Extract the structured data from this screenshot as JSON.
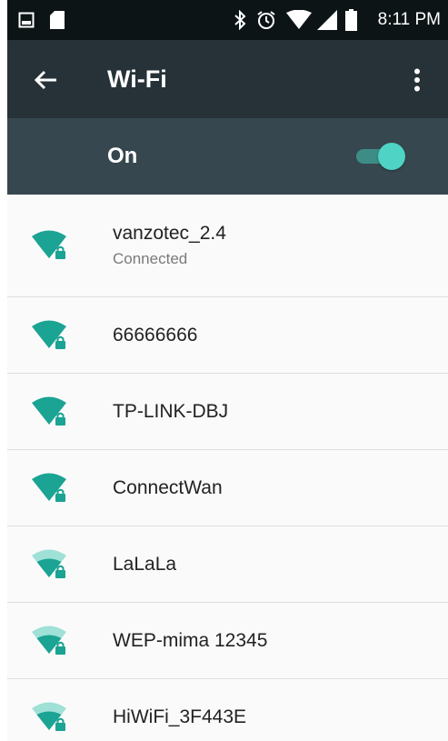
{
  "status_bar": {
    "time": "8:11 PM",
    "icons": [
      "image-icon",
      "sd-card-icon",
      "bluetooth-icon",
      "alarm-icon",
      "wifi-signal-icon",
      "cell-signal-icon",
      "battery-icon"
    ]
  },
  "app_bar": {
    "title": "Wi-Fi",
    "back_icon": "arrow-back-icon",
    "menu_icon": "more-vert-icon"
  },
  "toggle": {
    "label": "On",
    "state": "on"
  },
  "colors": {
    "accent": "#1ba393",
    "accent_weak": "#7fd4c8",
    "app_bar": "#263238",
    "toggle_bar": "#37474f",
    "status_bar": "#0d1416"
  },
  "networks": [
    {
      "ssid": "vanzotec_2.4",
      "status": "Connected",
      "signal": "strong",
      "secured": true
    },
    {
      "ssid": "66666666",
      "signal": "strong",
      "secured": true
    },
    {
      "ssid": "TP-LINK-DBJ",
      "signal": "strong",
      "secured": true
    },
    {
      "ssid": "ConnectWan",
      "signal": "strong",
      "secured": true
    },
    {
      "ssid": "LaLaLa",
      "signal": "medium",
      "secured": true
    },
    {
      "ssid": "WEP-mima 12345",
      "signal": "medium",
      "secured": true
    },
    {
      "ssid": "HiWiFi_3F443E",
      "signal": "medium",
      "secured": true
    }
  ]
}
